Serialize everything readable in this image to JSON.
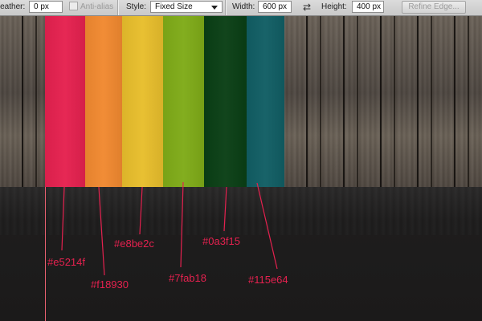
{
  "options_bar": {
    "feather_label": "Feather:",
    "feather_value": "0 px",
    "antialias_label": "Anti-alias",
    "style_label": "Style:",
    "style_value": "Fixed Size",
    "width_label": "Width:",
    "width_value": "600 px",
    "height_label": "Height:",
    "height_value": "400 px",
    "refine_edge_label": "Refine Edge...",
    "swap_icon": "swap-arrows-icon"
  },
  "palette": {
    "swatches": [
      {
        "color": "#e5214f",
        "label": "#e5214f"
      },
      {
        "color": "#f18930",
        "label": "#f18930"
      },
      {
        "color": "#e8be2c",
        "label": "#e8be2c"
      },
      {
        "color": "#7fab18",
        "label": "#7fab18"
      },
      {
        "color": "#0a3f15",
        "label": "#0a3f15"
      },
      {
        "color": "#115e64",
        "label": "#115e64"
      }
    ],
    "annotation_color": "#e5214f"
  }
}
